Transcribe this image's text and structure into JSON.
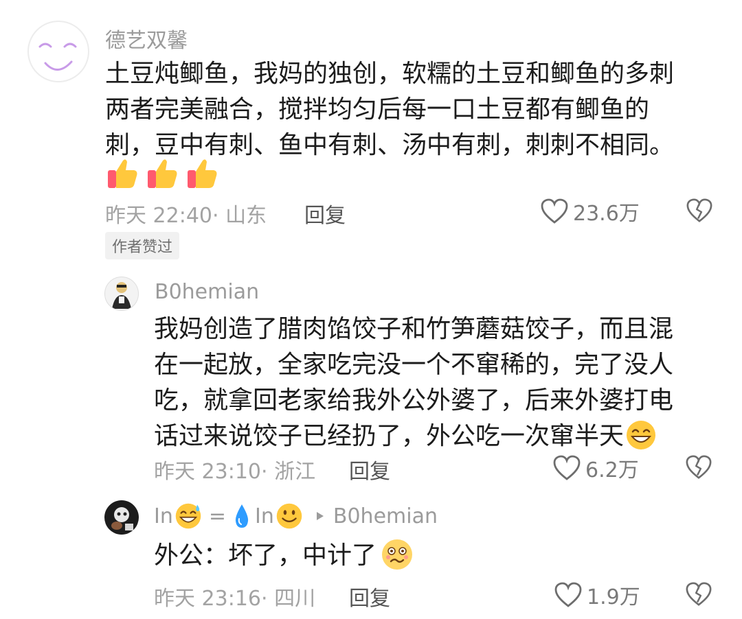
{
  "comments": [
    {
      "username": "德艺双馨",
      "body_lines": [
        "土豆炖鲫鱼，我妈的独创，软糯的土豆和鲫鱼的多刺",
        "两者完美融合，搅拌均匀后每一口土豆都有鲫鱼的",
        "刺，豆中有刺、鱼中有刺、汤中有刺，刺刺不相同。"
      ],
      "emoji_row": [
        "thumbs-up",
        "thumbs-up",
        "thumbs-up"
      ],
      "meta": "昨天 22:40· 山东",
      "reply_label": "回复",
      "likes": "23.6万",
      "badge": "作者赞过"
    },
    {
      "username": "B0hemian",
      "body_lines": [
        "我妈创造了腊肉馅饺子和竹笋蘑菇饺子，而且混",
        "在一起放，全家吃完没一个不窜稀的，完了没人",
        "吃，就拿回老家给我外公外婆了，后来外婆打电",
        "话过来说饺子已经扔了，外公吃一次窜半天"
      ],
      "trailing_emoji": "grin",
      "meta": "昨天 23:10· 浙江",
      "reply_label": "回复",
      "likes": "6.2万"
    },
    {
      "username_prefix": "In",
      "username_sep": "=",
      "username_mid": "In",
      "reply_to": "B0hemian",
      "body_lines": [
        "外公：坏了，中计了"
      ],
      "trailing_emoji": "woozy",
      "meta": "昨天 23:16· 四川",
      "reply_label": "回复",
      "likes": "1.9万"
    }
  ],
  "icons": {
    "like": "heart-outline-icon",
    "dislike": "broken-heart-icon",
    "reply_arrow": "right-triangle-icon"
  },
  "colors": {
    "text": "#1c1c1c",
    "muted": "#a3a3a3",
    "username": "#9b9b9b",
    "badge_bg": "#f1f1f1"
  }
}
